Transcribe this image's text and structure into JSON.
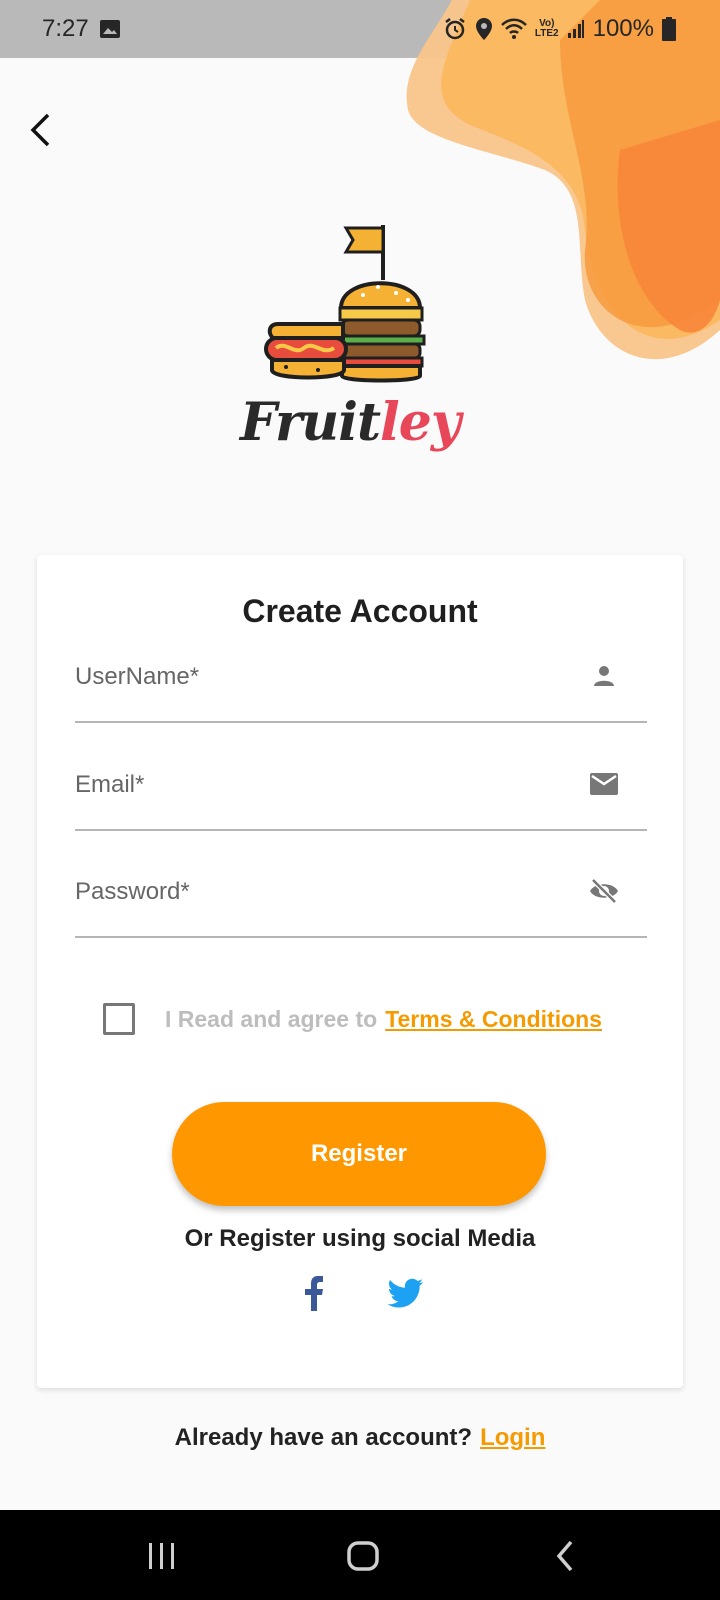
{
  "status_bar": {
    "time": "7:27",
    "battery": "100%",
    "network": "LTE2",
    "volte": "Vo)"
  },
  "header": {
    "back_icon": "chevron-left-icon"
  },
  "brand": {
    "name_part1": "Fruit",
    "name_part2": "ley"
  },
  "card": {
    "title": "Create Account",
    "fields": {
      "username": {
        "placeholder": "UserName*",
        "icon": "person-icon"
      },
      "email": {
        "placeholder": "Email*",
        "icon": "mail-icon"
      },
      "password": {
        "placeholder": "Password*",
        "icon": "visibility-off-icon"
      }
    },
    "terms": {
      "text": "I Read and agree to",
      "link": "Terms & Conditions",
      "checked": false
    },
    "register_label": "Register",
    "social_text": "Or Register using social Media",
    "social": {
      "facebook_icon": "facebook-icon",
      "twitter_icon": "twitter-icon"
    }
  },
  "footer": {
    "text": "Already have an account?",
    "login_label": "Login"
  },
  "colors": {
    "accent": "#ff9800",
    "link": "#f59a00",
    "brand_red": "#e8475a",
    "facebook": "#3b5998",
    "twitter": "#1da1f2"
  }
}
